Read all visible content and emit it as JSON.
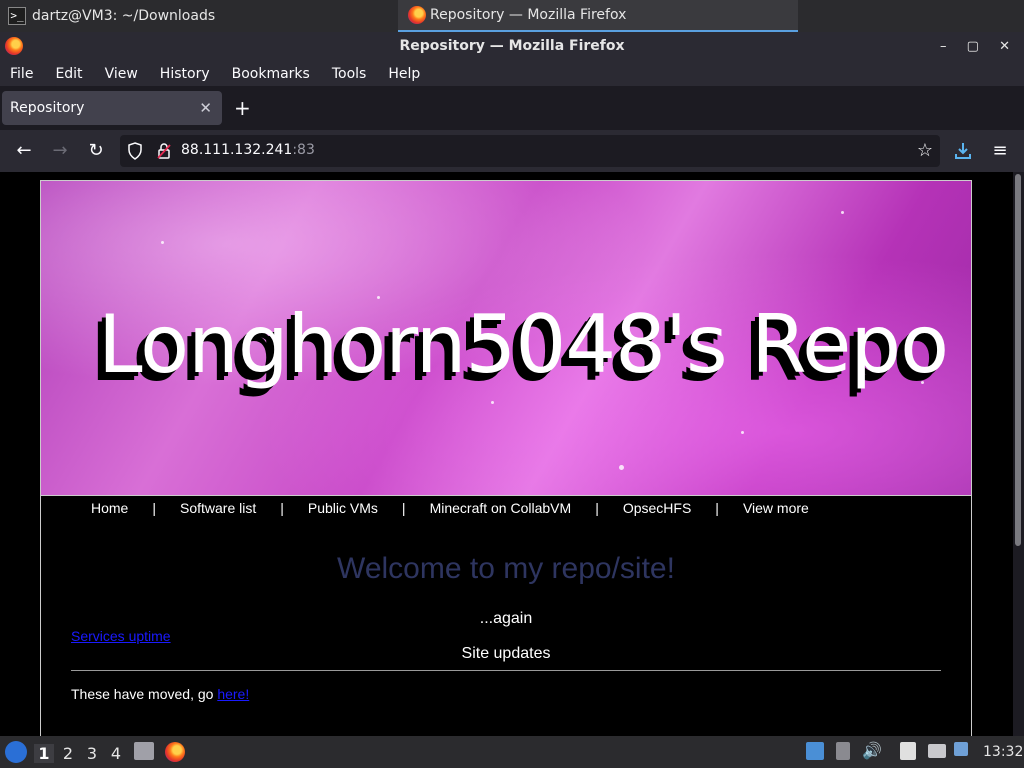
{
  "wm": {
    "terminal_title": "dartz@VM3: ~/Downloads",
    "firefox_title": "Repository — Mozilla Firefox"
  },
  "firefox": {
    "window_title": "Repository — Mozilla Firefox",
    "window_controls": "– ▢ ✕",
    "menu": [
      "File",
      "Edit",
      "View",
      "History",
      "Bookmarks",
      "Tools",
      "Help"
    ],
    "tab_title": "Repository",
    "url_host": "88.111.132.241",
    "url_port": ":83"
  },
  "site": {
    "banner_title": "Longhorn5048's Repo",
    "nav": [
      "Home",
      "Software list",
      "Public VMs",
      "Minecraft on CollabVM",
      "OpsecHFS",
      "View more"
    ],
    "nav_separator": "|",
    "welcome": "Welcome to my repo/site!",
    "again": "...again",
    "services_link": "Services uptime",
    "site_updates": "Site updates",
    "moved_text": "These have moved, go ",
    "moved_link": "here!"
  },
  "taskbar": {
    "workspaces": [
      "1",
      "2",
      "3",
      "4"
    ],
    "active_workspace": "1",
    "clock": "13:32"
  },
  "colors": {
    "welcome": "#2e3560",
    "link": "#1a1aff",
    "banner": "#c84bc8"
  }
}
